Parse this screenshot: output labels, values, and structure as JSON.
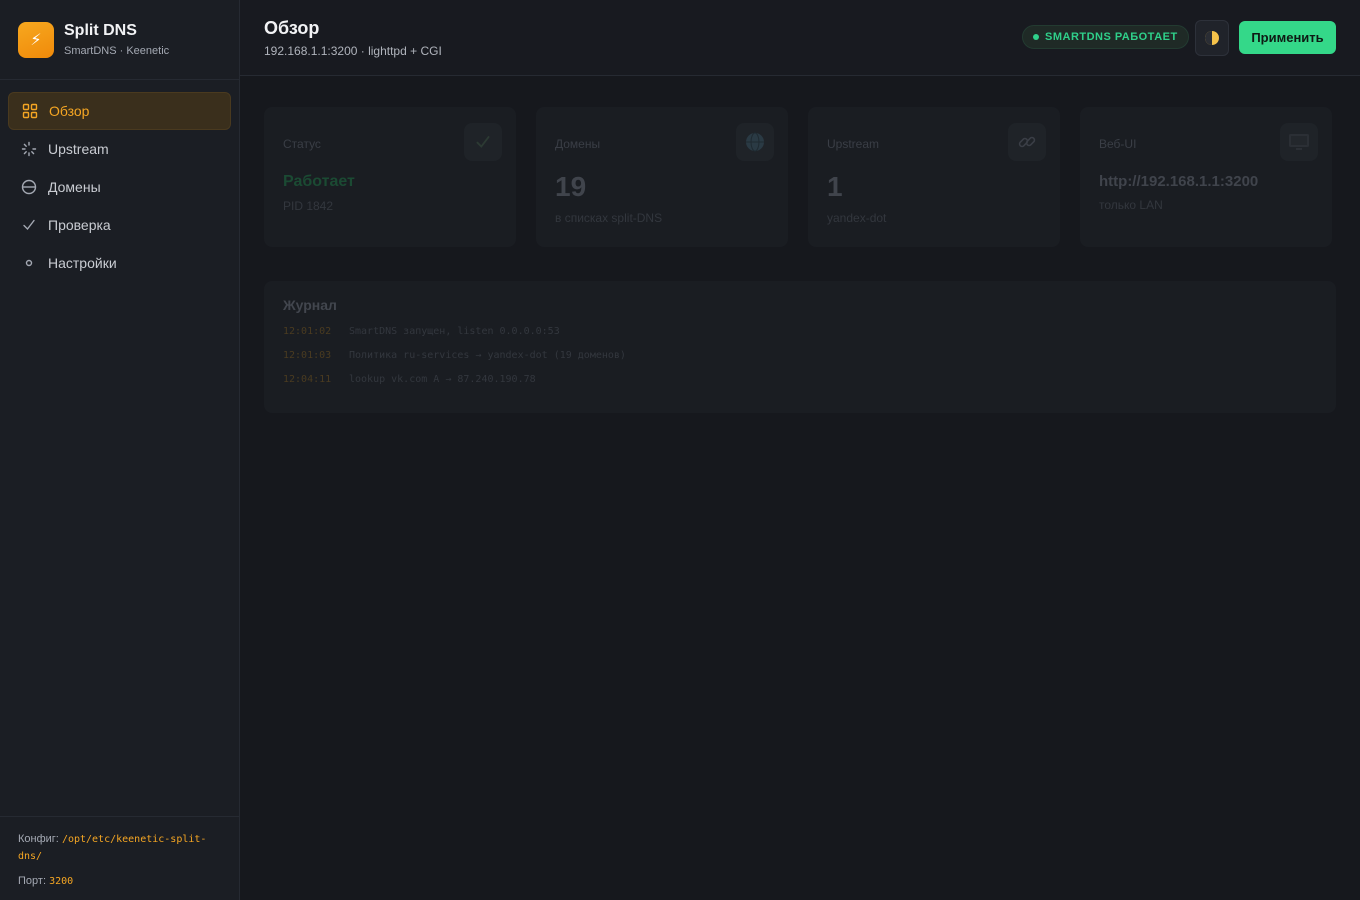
{
  "brand": {
    "logo_glyph": "⚡",
    "title": "Split DNS",
    "subtitle": "SmartDNS · Keenetic"
  },
  "nav": [
    {
      "label": "Обзор",
      "icon": "grid-icon",
      "active": true
    },
    {
      "label": "Upstream",
      "icon": "spinner-icon",
      "active": false
    },
    {
      "label": "Домены",
      "icon": "globe-icon",
      "active": false
    },
    {
      "label": "Проверка",
      "icon": "check-icon",
      "active": false
    },
    {
      "label": "Настройки",
      "icon": "gear-icon",
      "active": false
    }
  ],
  "footer": {
    "config_label": "Конфиг:",
    "config_path_1": "/opt/etc/keenetic-split-",
    "config_path_2": "dns/",
    "port_label": "Порт:",
    "port_value": "3200"
  },
  "header": {
    "title": "Обзор",
    "subtitle": "192.168.1.1:3200 · lighttpd + CGI",
    "status": "SMARTDNS РАБОТАЕТ",
    "apply_label": "Применить"
  },
  "cards": [
    {
      "label": "Статус",
      "value": "Работает",
      "note": "PID 1842",
      "icon": "check-icon"
    },
    {
      "label": "Домены",
      "value": "19",
      "note": "в списках split-DNS",
      "icon": "globe-icon"
    },
    {
      "label": "Upstream",
      "value": "1",
      "note": "yandex-dot",
      "icon": "link-icon"
    },
    {
      "label": "Веб-UI",
      "value": "http://192.168.1.1:3200",
      "note": "только LAN",
      "icon": "monitor-icon"
    }
  ],
  "journal": {
    "title": "Журнал",
    "lines": [
      {
        "time": "12:01:02",
        "msg": "SmartDNS запущен, listen 0.0.0.0:53"
      },
      {
        "time": "12:01:03",
        "msg": "Политика ru-services → yandex-dot (19 доменов)"
      },
      {
        "time": "12:04:11",
        "msg": "lookup vk.com A → 87.240.190.78"
      }
    ]
  },
  "colors": {
    "accent": "#f5a623",
    "success": "#34d889",
    "background": "#16181d"
  }
}
